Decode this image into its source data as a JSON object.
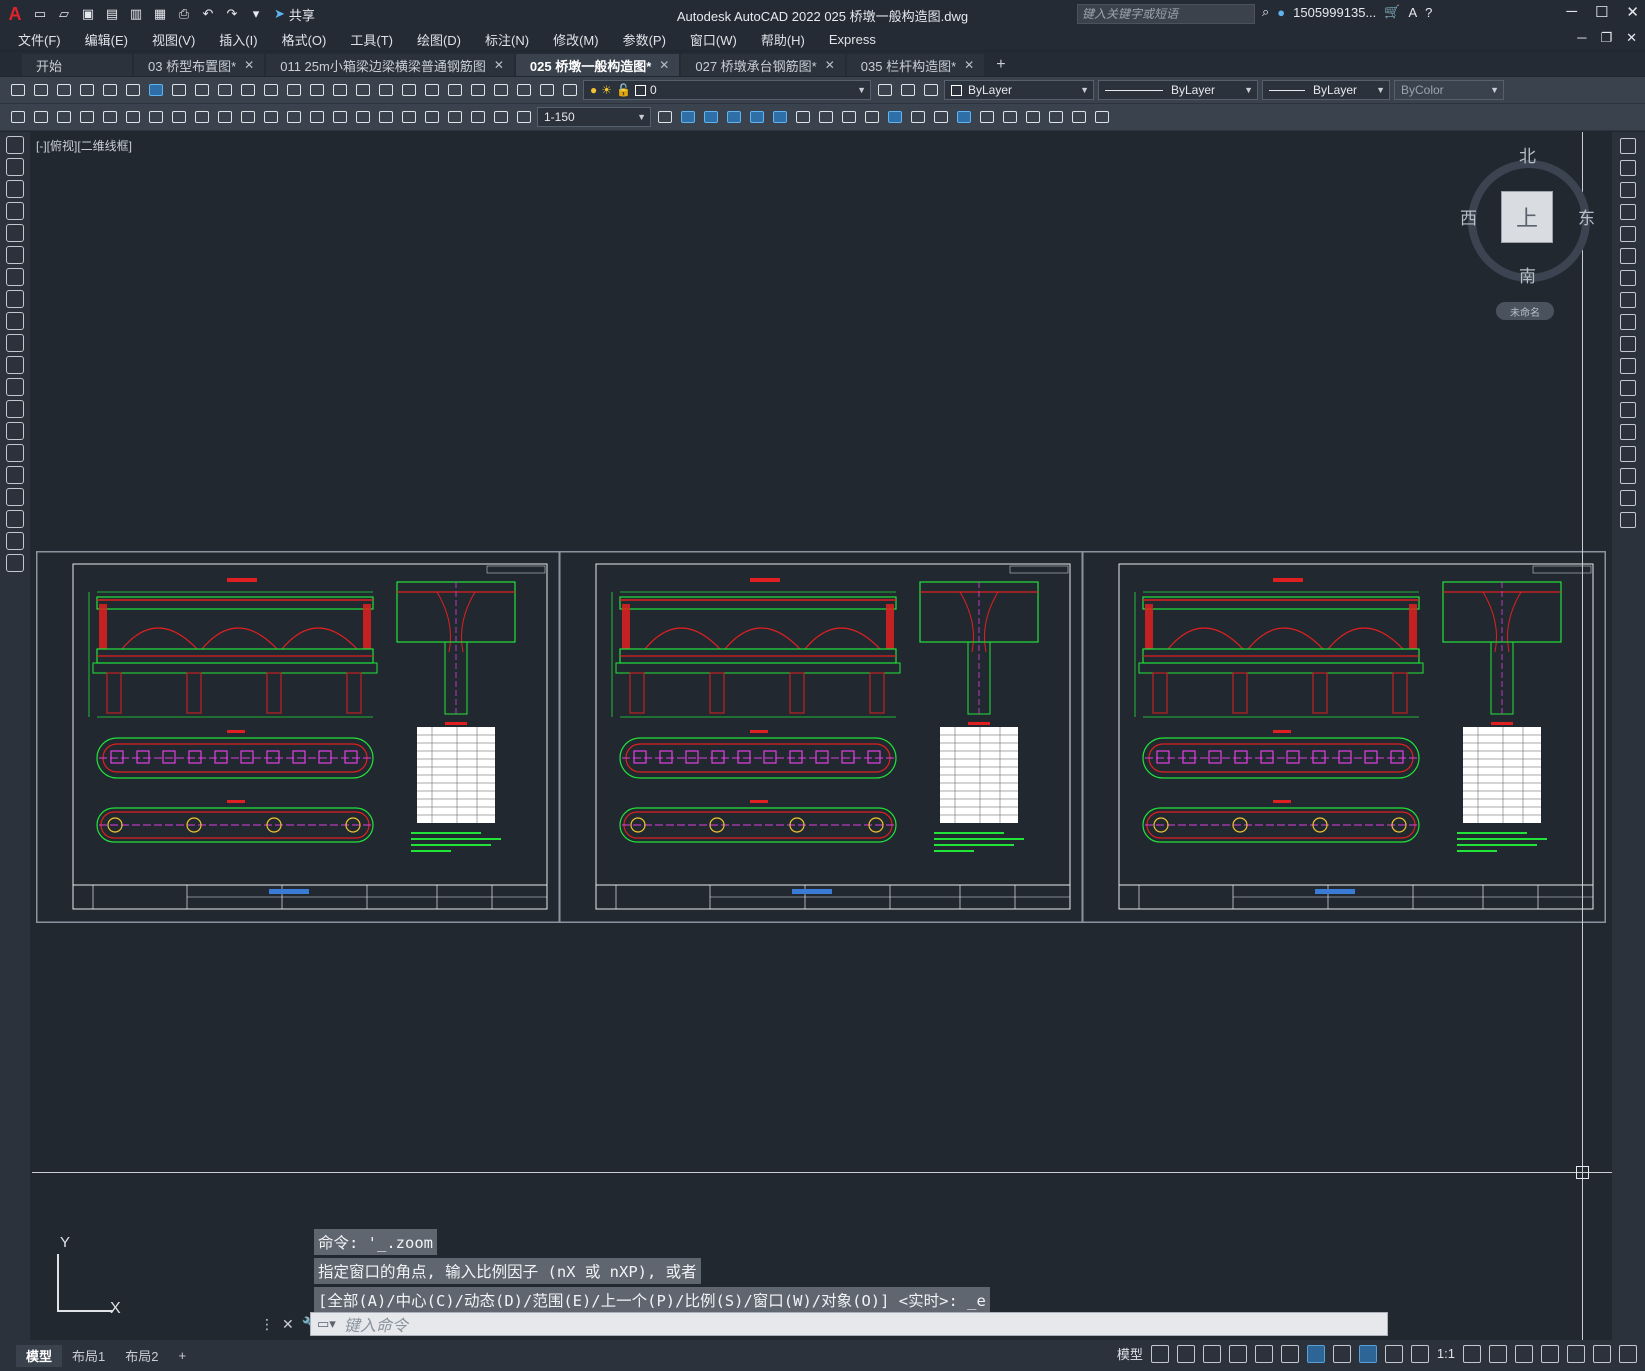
{
  "app": {
    "logo": "A",
    "title": "Autodesk AutoCAD 2022    025 桥墩一般构造图.dwg",
    "share_label": "共享",
    "search_placeholder": "键入关键字或短语",
    "user": "1505999135...",
    "qat_icons": [
      "new-icon",
      "open-icon",
      "save-icon",
      "saveas-icon",
      "plot-icon",
      "undo-icon",
      "redo-icon"
    ]
  },
  "menu": [
    "文件(F)",
    "编辑(E)",
    "视图(V)",
    "插入(I)",
    "格式(O)",
    "工具(T)",
    "绘图(D)",
    "标注(N)",
    "修改(M)",
    "参数(P)",
    "窗口(W)",
    "帮助(H)",
    "Express"
  ],
  "tabs": [
    {
      "label": "开始",
      "closable": false,
      "active": false
    },
    {
      "label": "03  桥型布置图*",
      "closable": true,
      "active": false
    },
    {
      "label": "011 25m小箱梁边梁横梁普通钢筋图",
      "closable": true,
      "active": false
    },
    {
      "label": "025 桥墩一般构造图*",
      "closable": true,
      "active": true
    },
    {
      "label": "027 桥墩承台钢筋图*",
      "closable": true,
      "active": false
    },
    {
      "label": "035 栏杆构造图*",
      "closable": true,
      "active": false
    }
  ],
  "toolbar": {
    "layer_value": "0",
    "color_value": "ByLayer",
    "linetype_value": "ByLayer",
    "lineweight_value": "ByLayer",
    "plotstyle_value": "ByColor",
    "scale_value": "1-150"
  },
  "viewport": {
    "label": "[-][俯视][二维线框]",
    "compass": {
      "north": "北",
      "south": "南",
      "east": "东",
      "west": "西",
      "face": "上"
    },
    "wcs_label": "未命名"
  },
  "ucs": {
    "x": "X",
    "y": "Y"
  },
  "command": {
    "history": [
      "命令: '_.zoom",
      "指定窗口的角点, 输入比例因子 (nX 或 nXP), 或者",
      "[全部(A)/中心(C)/动态(D)/范围(E)/上一个(P)/比例(S)/窗口(W)/对象(O)] <实时>: _e"
    ],
    "input_placeholder": "键入命令"
  },
  "layout_tabs": [
    "模型",
    "布局1",
    "布局2"
  ],
  "status": {
    "model_label": "模型",
    "scale": "1:1"
  },
  "colors": {
    "accent": "#5fb3f0",
    "drawing_green": "#22e33a",
    "drawing_red": "#e02020",
    "drawing_magenta": "#e040e0"
  }
}
